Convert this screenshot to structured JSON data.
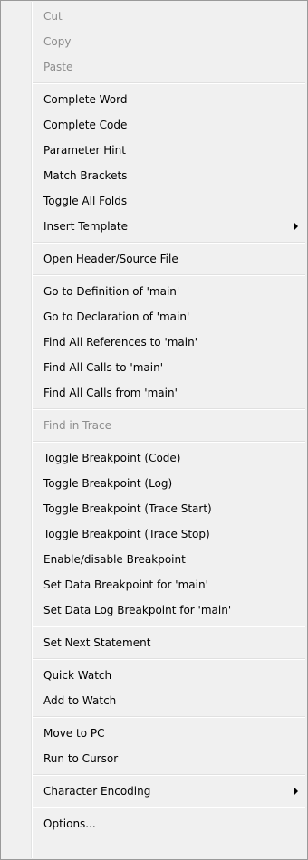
{
  "menu": {
    "groups": [
      [
        {
          "label": "Cut",
          "disabled": true
        },
        {
          "label": "Copy",
          "disabled": true
        },
        {
          "label": "Paste",
          "disabled": true
        }
      ],
      [
        {
          "label": "Complete Word"
        },
        {
          "label": "Complete Code"
        },
        {
          "label": "Parameter Hint"
        },
        {
          "label": "Match Brackets"
        },
        {
          "label": "Toggle All Folds"
        },
        {
          "label": "Insert Template",
          "submenu": true
        }
      ],
      [
        {
          "label": "Open Header/Source File"
        }
      ],
      [
        {
          "label": "Go to Definition of 'main'"
        },
        {
          "label": "Go to Declaration of 'main'"
        },
        {
          "label": "Find All References to 'main'"
        },
        {
          "label": "Find All Calls to 'main'"
        },
        {
          "label": "Find All Calls from 'main'"
        }
      ],
      [
        {
          "label": "Find in Trace",
          "disabled": true
        }
      ],
      [
        {
          "label": "Toggle Breakpoint (Code)"
        },
        {
          "label": "Toggle Breakpoint (Log)"
        },
        {
          "label": "Toggle Breakpoint (Trace Start)"
        },
        {
          "label": "Toggle Breakpoint (Trace Stop)"
        },
        {
          "label": "Enable/disable Breakpoint"
        },
        {
          "label": "Set Data Breakpoint for 'main'"
        },
        {
          "label": "Set Data Log Breakpoint for 'main'"
        }
      ],
      [
        {
          "label": "Set Next Statement"
        }
      ],
      [
        {
          "label": "Quick Watch"
        },
        {
          "label": "Add to Watch"
        }
      ],
      [
        {
          "label": "Move to PC"
        },
        {
          "label": "Run to Cursor"
        }
      ],
      [
        {
          "label": "Character Encoding",
          "submenu": true
        }
      ],
      [
        {
          "label": "Options..."
        }
      ]
    ]
  },
  "icons": {
    "submenu_arrow": "chevron-right-icon"
  },
  "colors": {
    "background": "#f0f0f0",
    "text": "#000000",
    "disabled_text": "#8d8d8d",
    "border": "#9a9a9a",
    "separator": "#e0e0e0"
  }
}
